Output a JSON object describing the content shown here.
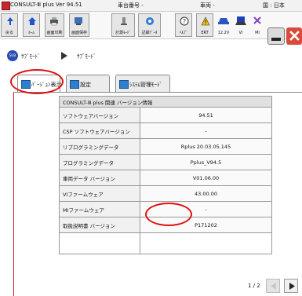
{
  "titlebar": {
    "app_name": "CONSULT-Ⅲ plus Ver 94.51",
    "vehicle_no": "車台番号 -",
    "car_name": "車両 -",
    "region": "国 : 日本"
  },
  "toolbar": {
    "buttons": [
      {
        "label": "戻る",
        "icon": "back-arrow-icon"
      },
      {
        "label": "ﾎｰﾑ",
        "icon": "home-icon"
      },
      {
        "label": "画面印刷",
        "icon": "screen-print-icon"
      },
      {
        "label": "画面保存",
        "icon": "screen-save-icon"
      },
      {
        "label": "計測ﾓｰﾄﾞ",
        "icon": "measure-mode-icon"
      },
      {
        "label": "記録ﾃﾞｰﾀ",
        "icon": "recorded-data-icon"
      },
      {
        "label": "ﾍﾙﾌﾟ",
        "icon": "help-icon"
      },
      {
        "label": "ERT",
        "icon": "warning-icon"
      }
    ],
    "status": [
      {
        "label": "12.2V",
        "icon": "battery-car-icon"
      },
      {
        "label": "VI",
        "icon": "vi-connection-icon"
      },
      {
        "label": "MI",
        "icon": "mi-not-connected-icon"
      }
    ]
  },
  "breadcrumb": {
    "home_icon_label": "SUB",
    "items": [
      "ｻﾌﾞﾓｰﾄﾞ",
      "ｻﾌﾞﾓｰﾄﾞ"
    ]
  },
  "tabs": [
    {
      "label": "ﾊﾞｰｼﾞｮﾝ表示",
      "active": true
    },
    {
      "label": "設定",
      "active": false
    },
    {
      "label": "ｼｽﾃﾑ管理ﾓｰﾄﾞ",
      "active": false
    }
  ],
  "table": {
    "header": "CONSULT-Ⅲ plus 関連 バージョン情報",
    "rows": [
      {
        "name": "ソフトウェアバージョン",
        "value": "94.51"
      },
      {
        "name": "CSP ソフトウェアバージョン",
        "value": "-"
      },
      {
        "name": "リプログラミングデータ",
        "value": "Rplus 20.03.05.145"
      },
      {
        "name": "プログラミングデータ",
        "value": "Pplus_V94.5"
      },
      {
        "name": "車両データ バージョン",
        "value": "V01.06.00"
      },
      {
        "name": "VIファームウェア",
        "value": "43.00.00"
      },
      {
        "name": "MIファームウェア",
        "value": "-"
      },
      {
        "name": "取扱説明書 バージョン",
        "value": "P171202"
      }
    ]
  },
  "pager": {
    "label": "1 / 2"
  },
  "colors": {
    "annotation_red": "#e01010",
    "active_border": "#d01c1c"
  }
}
